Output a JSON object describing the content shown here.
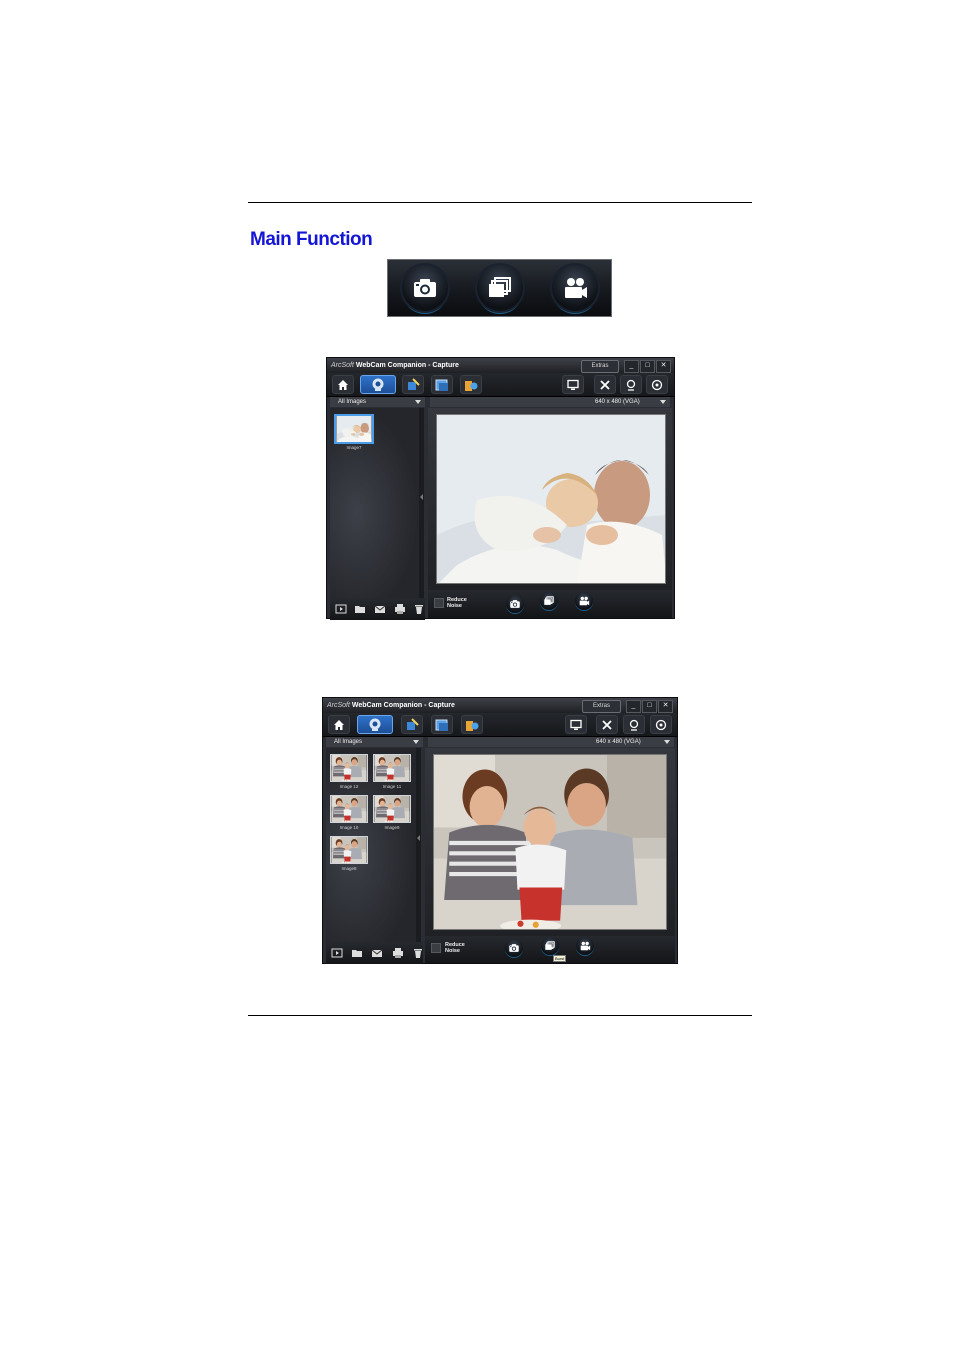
{
  "heading": "Main Function",
  "icons": {
    "photo": "camera-icon",
    "burst": "burst-icon",
    "video": "video-camera-icon"
  },
  "colors": {
    "heading": "#1515d6",
    "accent": "#2f72c9",
    "window_bg": "#2a2d33"
  },
  "window1": {
    "title_brand": "ArcSoft",
    "title_app": "WebCam Companion",
    "title_mode": "- Capture",
    "extras_label": "Extras",
    "filter_label": "All Images",
    "resolution_label": "640 x 480 (VGA)",
    "thumbnails": [
      {
        "label": "Image7",
        "selected": true
      }
    ],
    "reduce_noise_line1": "Reduce",
    "reduce_noise_line2": "Noise"
  },
  "window2": {
    "title_brand": "ArcSoft",
    "title_app": "WebCam Companion",
    "title_mode": "- Capture",
    "extras_label": "Extras",
    "filter_label": "All Images",
    "resolution_label": "640 x 480 (VGA)",
    "thumbnails": [
      {
        "label": "Image 12"
      },
      {
        "label": "Image 11"
      },
      {
        "label": "Image 10"
      },
      {
        "label": "Image9"
      },
      {
        "label": "Image8"
      }
    ],
    "reduce_noise_line1": "Reduce",
    "reduce_noise_line2": "Noise",
    "tooltip": "Burst"
  }
}
